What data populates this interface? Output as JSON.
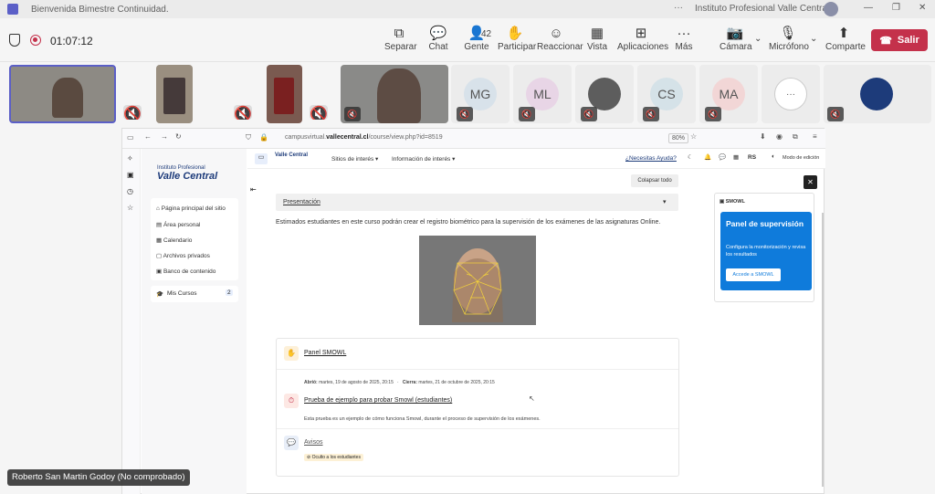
{
  "window": {
    "title": "Bienvenida Bimestre Continuidad.",
    "organization": "Instituto Profesional Valle Central",
    "menu_icon": "ellipsis-icon"
  },
  "meeting": {
    "timer": "01:07:12",
    "people_count": "42",
    "toolbar": [
      {
        "label": "Separar",
        "icon": "pop-out-icon"
      },
      {
        "label": "Chat",
        "icon": "chat-icon"
      },
      {
        "label": "Gente",
        "icon": "people-icon"
      },
      {
        "label": "Participar",
        "icon": "raise-hand-icon"
      },
      {
        "label": "Reaccionar",
        "icon": "smile-icon"
      },
      {
        "label": "Vista",
        "icon": "grid-icon"
      },
      {
        "label": "Aplicaciones",
        "icon": "plus-icon"
      },
      {
        "label": "Más",
        "icon": "more-icon"
      },
      {
        "label": "Cámara",
        "icon": "camera-off-icon"
      },
      {
        "label": "Micrófono",
        "icon": "mic-off-icon"
      },
      {
        "label": "Comparte",
        "icon": "share-icon"
      }
    ],
    "leave_label": "Salir"
  },
  "participants": [
    {
      "type": "video",
      "muted": false
    },
    {
      "type": "video",
      "muted": true
    },
    {
      "type": "video",
      "muted": true
    },
    {
      "type": "video",
      "muted": true
    },
    {
      "type": "initials",
      "initials": "MG",
      "muted": true,
      "color": "#d8e2ea"
    },
    {
      "type": "initials",
      "initials": "ML",
      "muted": true,
      "color": "#e8d5e6"
    },
    {
      "type": "photo",
      "muted": true
    },
    {
      "type": "initials",
      "initials": "CS",
      "muted": true,
      "color": "#d5e2e8"
    },
    {
      "type": "initials",
      "initials": "MA",
      "muted": true,
      "color": "#f2d6d6"
    },
    {
      "type": "overflow",
      "initials": "···",
      "muted": false
    },
    {
      "type": "logo",
      "muted": true
    }
  ],
  "browser": {
    "url_prefix": "campusvirtual.",
    "url_domain": "vallecentral.cl",
    "url_path": "/course/view.php?id=8519",
    "zoom": "80%"
  },
  "lms": {
    "brand_small": "Instituto Profesional",
    "brand_big": "Valle Central",
    "nav": [
      "Página principal del sitio",
      "Área personal",
      "Calendario",
      "Archivos privados",
      "Banco de contenido"
    ],
    "my_courses": "Mis Cursos",
    "my_courses_count": "2",
    "top_menu": [
      "Sitios de interés",
      "Información de interés"
    ],
    "help_link": "¿Necesitas Ayuda?",
    "user_initials": "RS",
    "edit_mode": "Modo de edición",
    "collapse_all": "Colapsar todo",
    "section_title": "Presentación",
    "intro_text": "Estimados estudiantes en este curso podrán crear el registro biométrico para la supervisión de los exámenes de las asignaturas Online.",
    "activities": [
      {
        "title": "Panel SMOWL",
        "icon": "hand-icon"
      },
      {
        "title": "Prueba de ejemplo para probar Smowl (estudiantes)",
        "icon": "quiz-icon",
        "opened_label": "Abrió:",
        "opened": "martes, 19 de agosto de 2025, 20:15",
        "closes_label": "Cierra:",
        "closes": "martes, 21 de octubre de 2025, 20:15",
        "description": "Esta prueba es un ejemplo de cómo funciona Smowl, durante el proceso de supervisión de los exámenes."
      },
      {
        "title": "Avisos",
        "icon": "forum-icon",
        "badge": "Oculto a los estudiantes"
      }
    ],
    "drawer": {
      "label": "SMOWL",
      "panel_title": "Panel de supervisión",
      "panel_desc": "Configura la monitorización y revisa los resultados",
      "panel_button": "Accede a SMOWL"
    }
  },
  "speaker_label": "Roberto San Martin Godoy (No comprobado)"
}
